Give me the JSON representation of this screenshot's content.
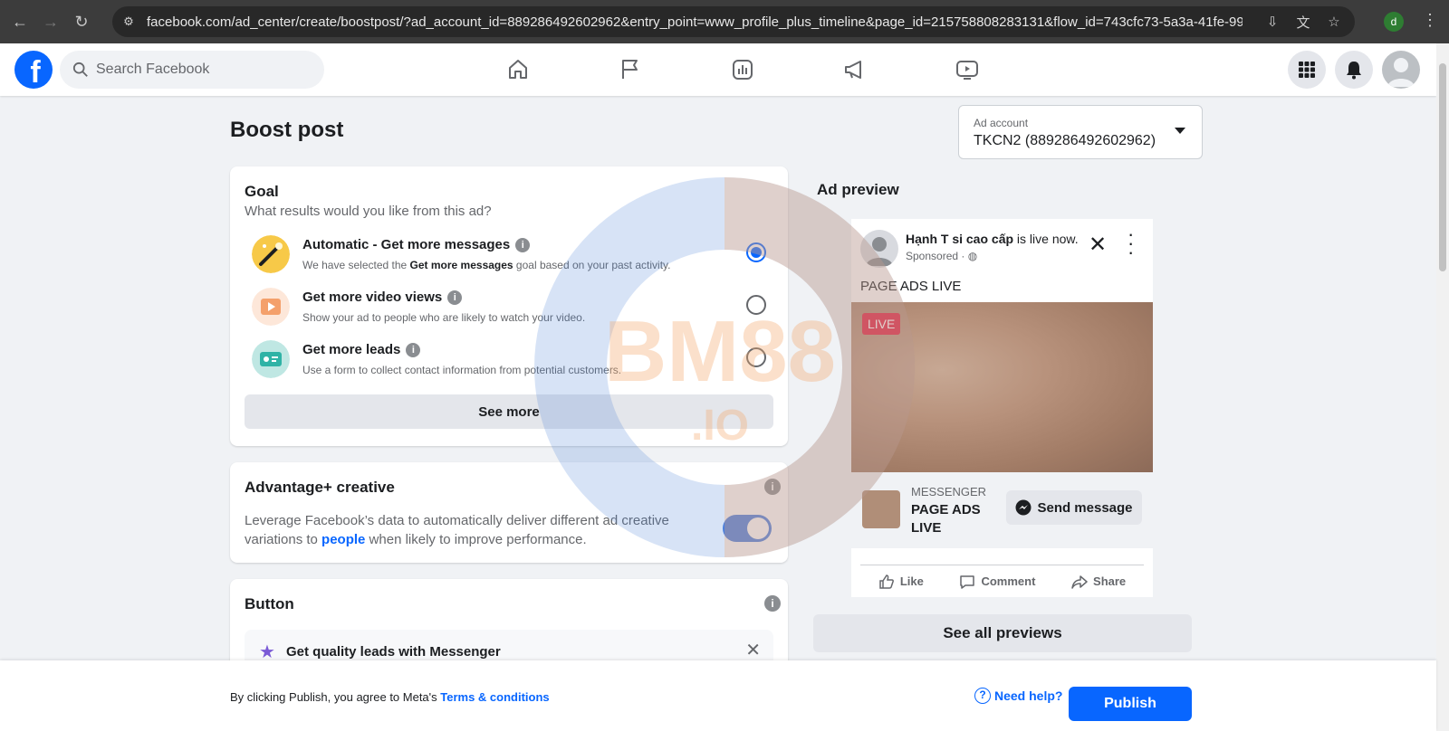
{
  "browser": {
    "url": "facebook.com/ad_center/create/boostpost/?ad_account_id=889286492602962&entry_point=www_profile_plus_timeline&page_id=215758808283131&flow_id=743cfc73-5a3a-41fe-99b0-ccc...",
    "profile_initial": "d"
  },
  "topbar": {
    "search_placeholder": "Search Facebook",
    "nav_icons": [
      "home-icon",
      "flag-icon",
      "chart-icon",
      "megaphone-icon",
      "video-icon"
    ],
    "accent": "#0866ff"
  },
  "page": {
    "title": "Boost post",
    "ad_account_label": "Ad account",
    "ad_account_value": "TKCN2 (889286492602962)"
  },
  "goal": {
    "title": "Goal",
    "subtitle": "What results would you like from this ad?",
    "options": [
      {
        "title": "Automatic - Get more messages",
        "desc_pre": "We have selected the ",
        "desc_bold": "Get more messages",
        "desc_post": " goal based on your past activity.",
        "selected": true
      },
      {
        "title": "Get more video views",
        "desc": "Show your ad to people who are likely to watch your video.",
        "selected": false
      },
      {
        "title": "Get more leads",
        "desc": "Use a form to collect contact information from potential customers.",
        "selected": false
      }
    ],
    "see_more": "See more"
  },
  "advantage": {
    "title": "Advantage+ creative",
    "desc_pre": "Leverage Facebook’s data to automatically deliver different ad creative variations to ",
    "desc_link": "people",
    "desc_post": " when likely to improve performance.",
    "enabled": true
  },
  "button_section": {
    "title": "Button",
    "tip": "Get quality leads with Messenger"
  },
  "preview": {
    "heading": "Ad preview",
    "page_name": "Hạnh T si cao cấp",
    "status": " is live now.",
    "sponsored": "Sponsored ·",
    "caption": "PAGE ADS LIVE",
    "live_badge": "LIVE",
    "cta_kicker": "MESSENGER",
    "cta_title": "PAGE ADS LIVE",
    "cta_button": "Send message",
    "actions": [
      "Like",
      "Comment",
      "Share"
    ],
    "see_all": "See all previews"
  },
  "footer": {
    "legal_pre": "By clicking Publish, you agree to Meta's ",
    "legal_link": "Terms & conditions",
    "help": "Need help?",
    "publish": "Publish"
  },
  "watermark": {
    "text_main": "BM88",
    "text_sub": ".IO"
  }
}
